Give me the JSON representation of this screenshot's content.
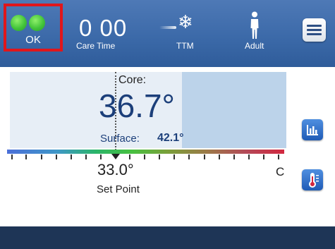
{
  "status": {
    "label": "OK",
    "indicator_color": "#43c43a",
    "highlight_color": "#e0161b"
  },
  "care_time": {
    "value": "0 00",
    "label": "Care Time"
  },
  "mode": {
    "label": "TTM",
    "icon": "snowflake-icon"
  },
  "patient": {
    "label": "Adult",
    "icon": "person-icon"
  },
  "menu": {
    "icon": "hamburger-menu-icon"
  },
  "temperature": {
    "core_label": "Core:",
    "core_value": "36.7°",
    "surface_label": "Surface:",
    "surface_value": "42.1°",
    "set_point_value": "33.0°",
    "set_point_label": "Set Point",
    "unit": "C"
  },
  "side_buttons": [
    {
      "name": "trend-chart-button",
      "icon": "bar-chart-icon"
    },
    {
      "name": "temperature-button",
      "icon": "thermometer-icon"
    }
  ]
}
